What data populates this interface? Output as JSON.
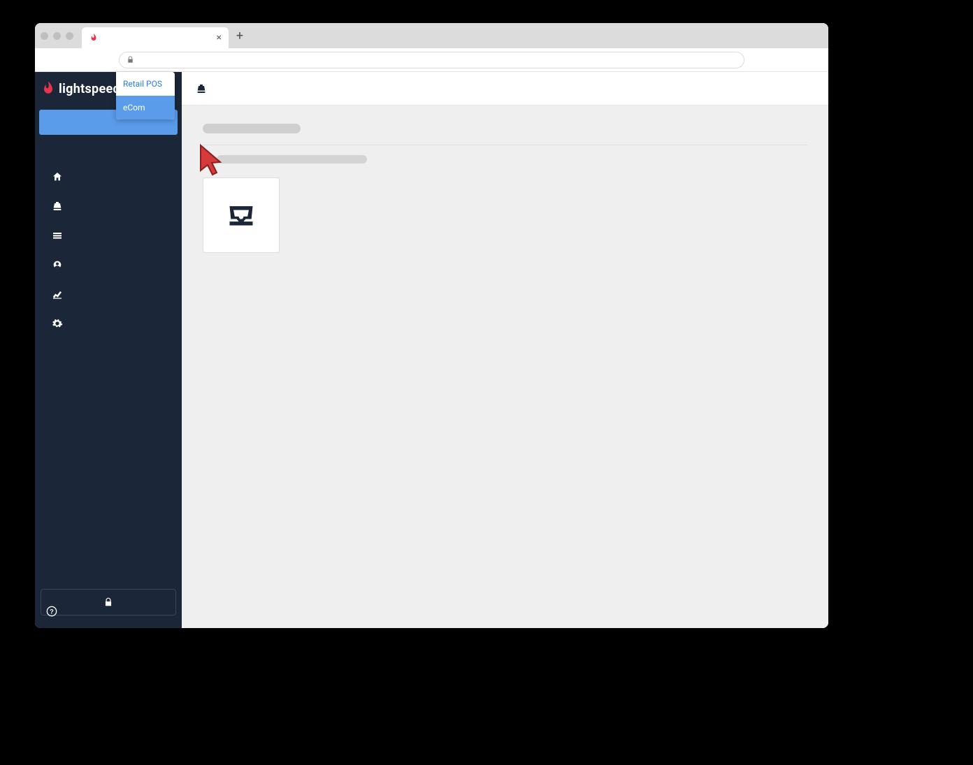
{
  "browser": {
    "tab_title": "",
    "close_glyph": "×",
    "newtab_glyph": "+"
  },
  "brand": {
    "name": "lightspeed"
  },
  "switcher": {
    "options": [
      {
        "label": "Retail POS",
        "selected": false
      },
      {
        "label": "eCom",
        "selected": true
      }
    ]
  },
  "sidebar": {
    "nav_icons": [
      "home",
      "register",
      "inventory",
      "customers",
      "reports",
      "settings"
    ]
  }
}
